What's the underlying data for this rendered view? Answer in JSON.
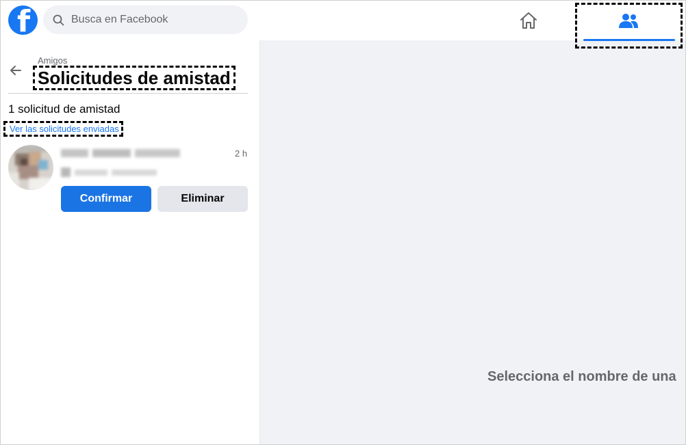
{
  "header": {
    "logo_letter": "f",
    "search_placeholder": "Busca en Facebook",
    "brand_color": "#1877f2"
  },
  "nav": {
    "home_icon": "home-icon",
    "friends_icon": "friends-icon",
    "active": "friends"
  },
  "sidebar": {
    "breadcrumb": "Amigos",
    "title": "Solicitudes de amistad",
    "request_count": "1 solicitud de amistad",
    "sent_requests_link": "Ver las solicitudes enviadas",
    "requests": [
      {
        "time": "2 h",
        "confirm_label": "Confirmar",
        "delete_label": "Eliminar"
      }
    ]
  },
  "main": {
    "empty_message": "Selecciona el nombre de una"
  }
}
